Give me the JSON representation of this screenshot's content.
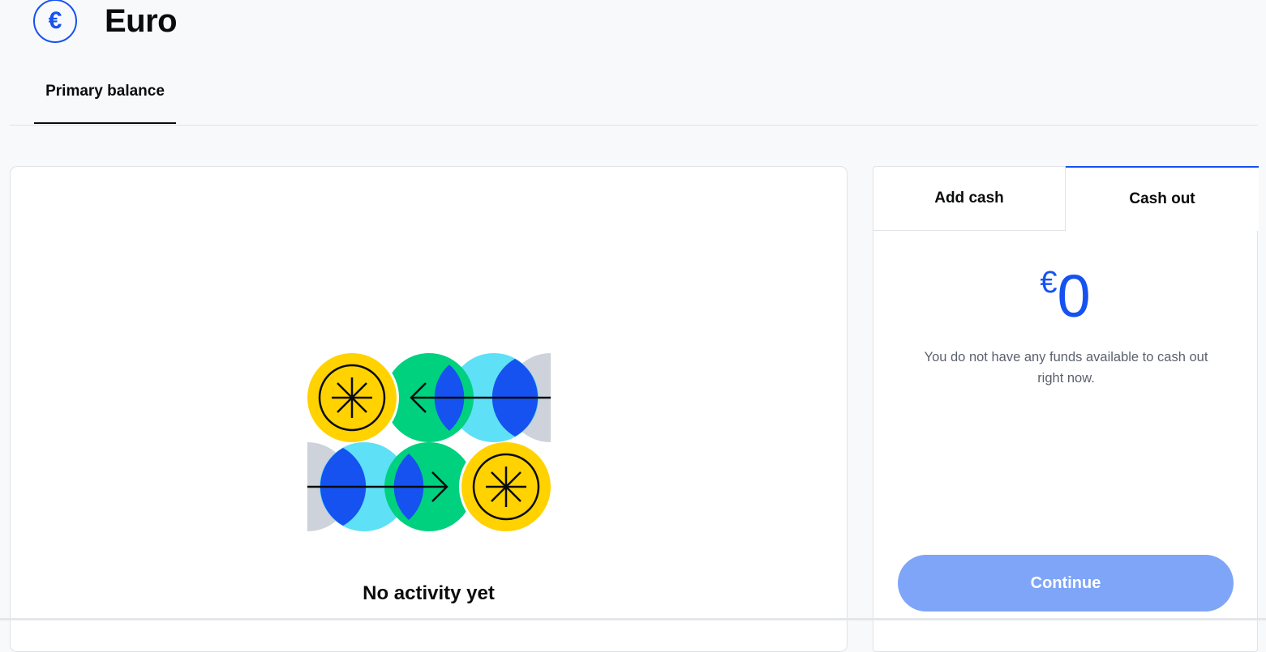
{
  "header": {
    "currency_symbol": "€",
    "title": "Euro"
  },
  "tabs": [
    {
      "label": "Primary balance",
      "active": true
    }
  ],
  "activity": {
    "empty_message": "No activity yet"
  },
  "cash_panel": {
    "tabs": [
      {
        "label": "Add cash",
        "active": false
      },
      {
        "label": "Cash out",
        "active": true
      }
    ],
    "currency_symbol": "€",
    "amount": "0",
    "notice": "You do not have any funds available to cash out right now.",
    "continue_label": "Continue"
  },
  "colors": {
    "accent": "#1652f0",
    "button_disabled": "#7ea5f8",
    "yellow": "#ffd200",
    "green": "#00d17f",
    "cyan": "#5ee0f7",
    "gray": "#ced2da"
  }
}
